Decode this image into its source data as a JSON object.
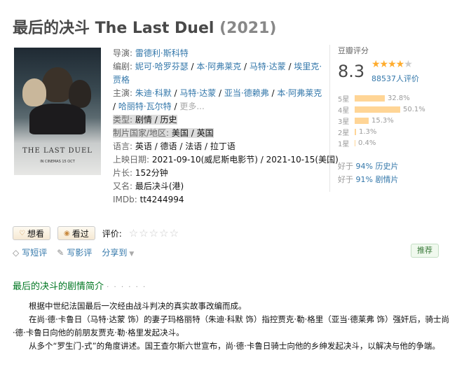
{
  "title": {
    "main": "最后的决斗 The Last Duel",
    "year": "(2021)"
  },
  "poster": {
    "title": "THE LAST DUEL",
    "date": "IN CINEMAS 15 OCT"
  },
  "info": {
    "director_label": "导演:",
    "director": "雷德利·斯科特",
    "writer_label": "编剧:",
    "writers": [
      "妮可·哈罗芬瑟",
      "本·阿弗莱克",
      "马特·达蒙",
      "埃里克·贾格"
    ],
    "cast_label": "主演:",
    "cast": [
      "朱迪·科默",
      "马特·达蒙",
      "亚当·德赖弗",
      "本·阿弗莱克",
      "哈丽特·瓦尔特"
    ],
    "cast_more": "更多...",
    "genre_label": "类型:",
    "genre": "剧情 / 历史",
    "country_label": "制片国家/地区:",
    "country": "美国 / 英国",
    "language_label": "语言:",
    "language": "英语 / 德语 / 法语 / 拉丁语",
    "release_label": "上映日期:",
    "release": "2021-09-10(威尼斯电影节) / 2021-10-15(美国)",
    "runtime_label": "片长:",
    "runtime": "152分钟",
    "aka_label": "又名:",
    "aka": "最后决斗(港)",
    "imdb_label": "IMDb:",
    "imdb": "tt4244994"
  },
  "rating": {
    "label": "豆瓣评分",
    "score": "8.3",
    "stars_filled": 4,
    "stars_total": 5,
    "count": "88537人评价",
    "distribution": [
      {
        "star": "5星",
        "pct": "32.8%",
        "value": 32.8
      },
      {
        "star": "4星",
        "pct": "50.1%",
        "value": 50.1
      },
      {
        "star": "3星",
        "pct": "15.3%",
        "value": 15.3
      },
      {
        "star": "2星",
        "pct": "1.3%",
        "value": 1.3
      },
      {
        "star": "1星",
        "pct": "0.4%",
        "value": 0.4
      }
    ],
    "better_prefix": "好于",
    "better": [
      {
        "pct": "94%",
        "genre": "历史片"
      },
      {
        "pct": "91%",
        "genre": "剧情片"
      }
    ]
  },
  "actions": {
    "want": "想看",
    "seen": "看过",
    "rate_label": "评价:"
  },
  "tools": {
    "short_review": "写短评",
    "review": "写影评",
    "share": "分享到"
  },
  "recommend": "推荐",
  "synopsis": {
    "heading": "最后的决斗的剧情简介",
    "dots": "· · · · · ·",
    "paragraphs": [
      "根据中世纪法国最后一次经由战斗判决的真实故事改编而成。",
      "在尚·德·卡鲁日（马特·达蒙 饰）的妻子玛格丽特（朱迪·科默 饰）指控贾克·勒·格里（亚当·德莱弗 饰）强奸后，骑士尚·德·卡鲁日向他的前朋友贾克·勒·格里发起决斗。",
      "从多个“罗生门-式”的角度讲述。国王查尔斯六世宣布，尚·德·卡鲁日骑士向他的乡绅发起决斗，以解决与他的争端。"
    ]
  }
}
